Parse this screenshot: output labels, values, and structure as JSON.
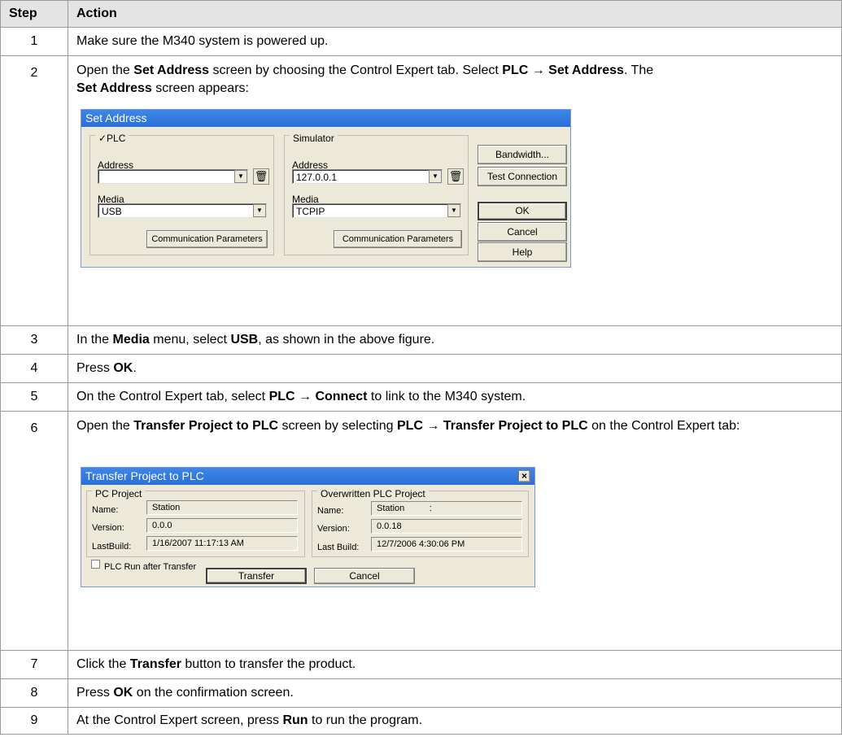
{
  "table": {
    "headers": {
      "step": "Step",
      "action": "Action"
    },
    "rows": {
      "r1": {
        "step": "1",
        "text": "Make sure the M340 system is powered up."
      },
      "r2": {
        "step": "2",
        "p1": "Open the ",
        "b1": "Set Address",
        "p2": " screen by choosing the Control Expert tab. Select ",
        "b2": "PLC → Set Address",
        "p3": ". The ",
        "b3": "Set Address",
        "p4": " screen appears:"
      },
      "r3": {
        "step": "3",
        "p1": "In the ",
        "b1": "Media",
        "p2": " menu, select ",
        "b2": "USB",
        "p3": ", as shown in the above figure."
      },
      "r4": {
        "step": "4",
        "p1": "Press ",
        "b1": "OK",
        "p2": "."
      },
      "r5": {
        "step": "5",
        "p1": "On the Control Expert tab, select ",
        "b1": "PLC → Connect",
        "p2": " to link to the M340 system."
      },
      "r6": {
        "step": "6",
        "p1": "Open the ",
        "b1": "Transfer Project to PLC",
        "p2": " screen by selecting ",
        "b2": "PLC → Transfer Project to PLC",
        "p3": " on the Control Expert tab:"
      },
      "r7": {
        "step": "7",
        "p1": "Click the ",
        "b1": "Transfer",
        "p2": " button to transfer the product."
      },
      "r8": {
        "step": "8",
        "p1": "Press ",
        "b1": "OK",
        "p2": " on the confirmation screen."
      },
      "r9": {
        "step": "9",
        "p1": "At the Control Expert screen, press ",
        "b1": "Run",
        "p2": " to run the program."
      }
    }
  },
  "set_address": {
    "title": "Set Address",
    "plc": {
      "group": "✓PLC",
      "address_label": "Address",
      "address_value": "",
      "media_label": "Media",
      "media_value": "USB",
      "comm_button": "Communication Parameters"
    },
    "simulator": {
      "group": "Simulator",
      "address_label": "Address",
      "address_value": "127.0.0.1",
      "media_label": "Media",
      "media_value": "TCPIP",
      "comm_button": "Communication Parameters"
    },
    "buttons": {
      "bandwidth": "Bandwidth...",
      "test": "Test Connection",
      "ok": "OK",
      "cancel": "Cancel",
      "help": "Help"
    }
  },
  "transfer": {
    "title": "Transfer Project to PLC",
    "close_glyph": "×",
    "pc": {
      "group": "PC Project",
      "name_label": "Name:",
      "name_value": "Station",
      "version_label": "Version:",
      "version_value": "0.0.0",
      "build_label": "LastBuild:",
      "build_value": "1/16/2007 11:17:13 AM"
    },
    "plc": {
      "group": "Overwritten PLC Project",
      "name_label": "Name:",
      "name_value": "Station          :",
      "version_label": "Version:",
      "version_value": "0.0.18",
      "build_label": "Last Build:",
      "build_value": "12/7/2006 4:30:06 PM"
    },
    "run_after": "PLC Run after Transfer",
    "buttons": {
      "transfer": "Transfer",
      "cancel": "Cancel"
    }
  }
}
